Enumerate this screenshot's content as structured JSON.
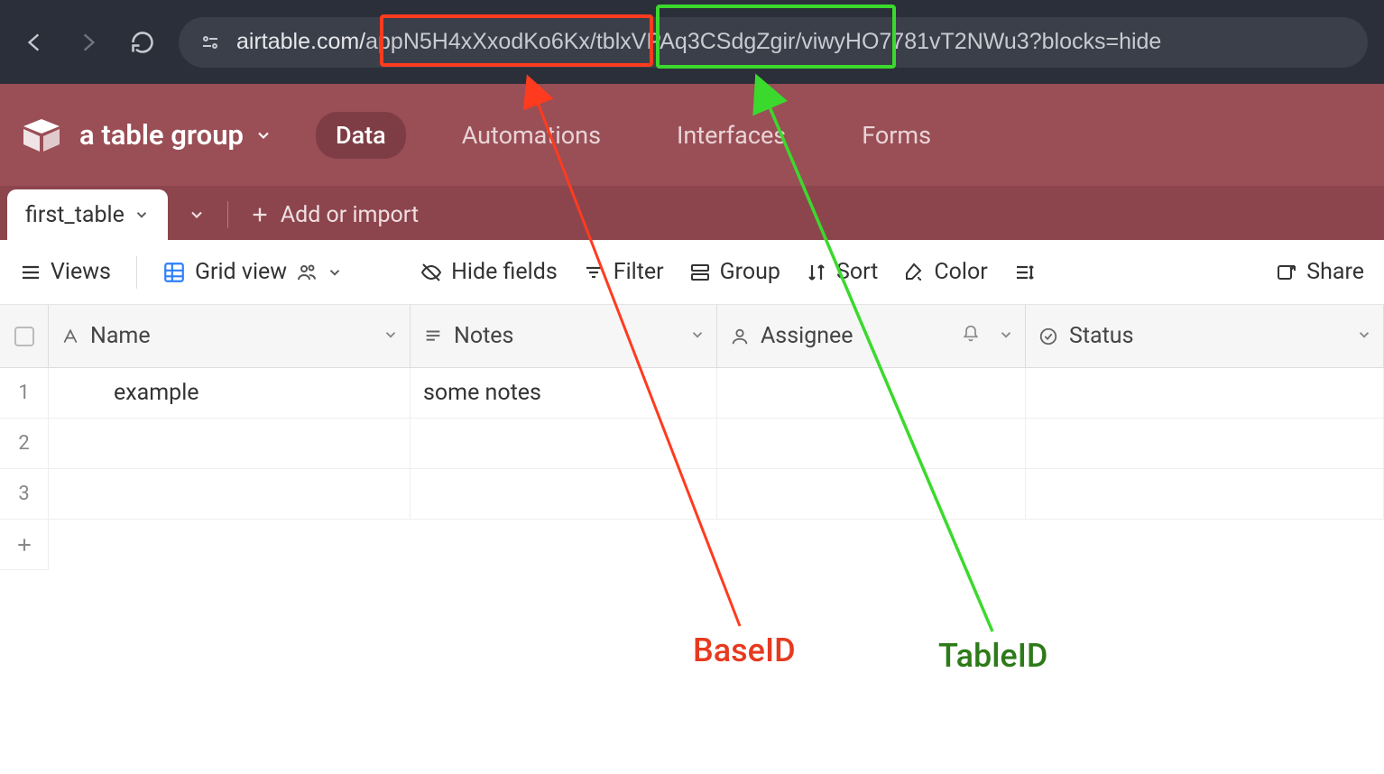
{
  "browser": {
    "url_prefix": "airtable.com/",
    "url_baseid": "appN5H4xXxodKo6Kx",
    "url_sep1": "/",
    "url_tableid": "tblxVPAq3CSdgZgir",
    "url_sep2": "/",
    "url_rest": "viwyHO7781vT2NWu3?blocks=hide"
  },
  "header": {
    "base_name": "a table group",
    "tabs": {
      "data": "Data",
      "automations": "Automations",
      "interfaces": "Interfaces",
      "forms": "Forms"
    }
  },
  "table_tabs": {
    "active": "first_table",
    "add_import": "Add or import"
  },
  "toolbar": {
    "views": "Views",
    "grid_view": "Grid view",
    "hide_fields": "Hide fields",
    "filter": "Filter",
    "group": "Group",
    "sort": "Sort",
    "color": "Color",
    "share": "Share"
  },
  "columns": {
    "name": "Name",
    "notes": "Notes",
    "assignee": "Assignee",
    "status": "Status"
  },
  "rows": [
    {
      "num": "1",
      "name": "example",
      "notes": "some notes",
      "assignee": "",
      "status": ""
    },
    {
      "num": "2",
      "name": "",
      "notes": "",
      "assignee": "",
      "status": ""
    },
    {
      "num": "3",
      "name": "",
      "notes": "",
      "assignee": "",
      "status": ""
    }
  ],
  "annotations": {
    "base_label": "BaseID",
    "table_label": "TableID",
    "colors": {
      "base": "#ff3b1f",
      "table": "#3bd92d"
    }
  }
}
